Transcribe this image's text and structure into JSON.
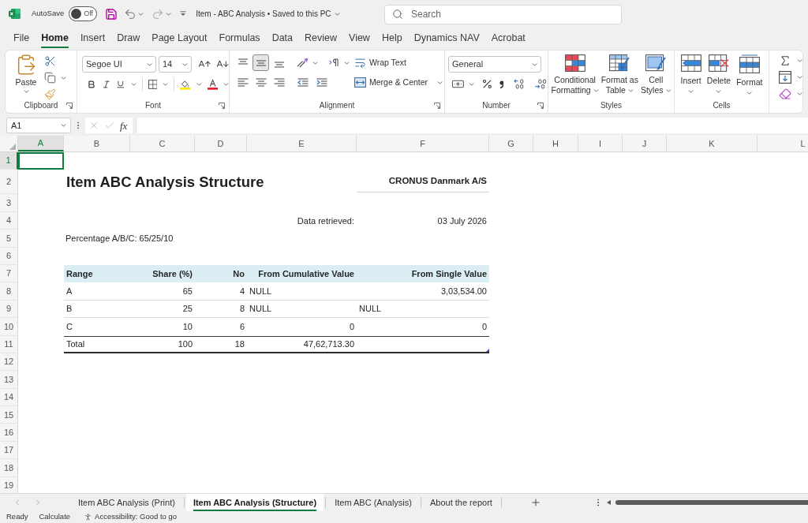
{
  "title_bar": {
    "autosave": {
      "label": "AutoSave",
      "state_label": "Off",
      "on": false
    },
    "document_title": "Item - ABC Analysis • Saved to this PC",
    "search": {
      "placeholder": "Search"
    }
  },
  "ribbon_tabs": [
    {
      "label": "File",
      "selected": false
    },
    {
      "label": "Home",
      "selected": true
    },
    {
      "label": "Insert",
      "selected": false
    },
    {
      "label": "Draw",
      "selected": false
    },
    {
      "label": "Page Layout",
      "selected": false
    },
    {
      "label": "Formulas",
      "selected": false
    },
    {
      "label": "Data",
      "selected": false
    },
    {
      "label": "Review",
      "selected": false
    },
    {
      "label": "View",
      "selected": false
    },
    {
      "label": "Help",
      "selected": false
    },
    {
      "label": "Dynamics NAV",
      "selected": false
    },
    {
      "label": "Acrobat",
      "selected": false
    }
  ],
  "ribbon": {
    "clipboard": {
      "label": "Clipboard",
      "paste": "Paste"
    },
    "font": {
      "label": "Font",
      "font_name": "Segoe UI",
      "font_size": "14"
    },
    "alignment": {
      "label": "Alignment",
      "vertical_align": [
        {
          "selected": false
        },
        {
          "selected": true
        },
        {
          "selected": false
        }
      ],
      "wrap_text": "Wrap Text",
      "merge": "Merge & Center"
    },
    "number": {
      "label": "Number",
      "format": "General"
    },
    "styles": {
      "label": "Styles",
      "buttons": [
        {
          "lines": [
            "Conditional",
            "Formatting"
          ]
        },
        {
          "lines": [
            "Format as",
            "Table"
          ]
        },
        {
          "lines": [
            "Cell",
            "Styles"
          ]
        }
      ]
    },
    "cells": {
      "label": "Cells",
      "buttons": [
        "Insert",
        "Delete",
        "Format"
      ]
    }
  },
  "formula_bar": {
    "name_box": "A1",
    "function_label": "fx"
  },
  "sheet": {
    "columns": [
      {
        "label": "A",
        "selected": true
      },
      {
        "label": "B",
        "selected": false
      },
      {
        "label": "C",
        "selected": false
      },
      {
        "label": "D",
        "selected": false
      },
      {
        "label": "E",
        "selected": false
      },
      {
        "label": "F",
        "selected": false
      },
      {
        "label": "G",
        "selected": false
      },
      {
        "label": "H",
        "selected": false
      },
      {
        "label": "I",
        "selected": false
      },
      {
        "label": "J",
        "selected": false
      },
      {
        "label": "K",
        "selected": false
      },
      {
        "label": "L",
        "selected": false
      }
    ],
    "rows": [
      {
        "label": "1",
        "selected": true
      },
      {
        "label": "2",
        "selected": false
      },
      {
        "label": "3",
        "selected": false
      },
      {
        "label": "4",
        "selected": false
      },
      {
        "label": "5",
        "selected": false
      },
      {
        "label": "6",
        "selected": false
      },
      {
        "label": "7",
        "selected": false
      },
      {
        "label": "8",
        "selected": false
      },
      {
        "label": "9",
        "selected": false
      },
      {
        "label": "10",
        "selected": false
      },
      {
        "label": "11",
        "selected": false
      },
      {
        "label": "12",
        "selected": false
      },
      {
        "label": "13",
        "selected": false
      },
      {
        "label": "14",
        "selected": false
      },
      {
        "label": "15",
        "selected": false
      },
      {
        "label": "16",
        "selected": false
      },
      {
        "label": "17",
        "selected": false
      },
      {
        "label": "18",
        "selected": false
      },
      {
        "label": "19",
        "selected": false
      }
    ],
    "report": {
      "title": "Item ABC Analysis Structure",
      "company": "CRONUS Danmark A/S",
      "retrieved_label": "Data retrieved:",
      "retrieved_date": "03 July 2026",
      "percentages": "Percentage A/B/C: 65/25/10",
      "table": {
        "columns": [
          {
            "label": "Range",
            "kind": "text"
          },
          {
            "label": "Share (%)",
            "kind": "number"
          },
          {
            "label": "No",
            "kind": "number"
          },
          {
            "label": "From Cumulative Value",
            "kind": "number"
          },
          {
            "label": "From Single Value",
            "kind": "number"
          }
        ],
        "rows": [
          {
            "kind": "data",
            "cells": [
              {
                "value": "A",
                "kind": "text"
              },
              {
                "value": "65",
                "kind": "number"
              },
              {
                "value": "4",
                "kind": "number"
              },
              {
                "value": "NULL",
                "kind": "text"
              },
              {
                "value": "3,03,534.00",
                "kind": "number"
              }
            ]
          },
          {
            "kind": "data",
            "cells": [
              {
                "value": "B",
                "kind": "text"
              },
              {
                "value": "25",
                "kind": "number"
              },
              {
                "value": "8",
                "kind": "number"
              },
              {
                "value": "NULL",
                "kind": "text"
              },
              {
                "value": "NULL",
                "kind": "text"
              }
            ]
          },
          {
            "kind": "data",
            "cells": [
              {
                "value": "C",
                "kind": "text"
              },
              {
                "value": "10",
                "kind": "number"
              },
              {
                "value": "6",
                "kind": "number"
              },
              {
                "value": "0",
                "kind": "number"
              },
              {
                "value": "0",
                "kind": "number"
              }
            ]
          },
          {
            "kind": "total",
            "cells": [
              {
                "value": "Total",
                "kind": "text"
              },
              {
                "value": "100",
                "kind": "number"
              },
              {
                "value": "18",
                "kind": "number"
              },
              {
                "value": "47,62,713.30",
                "kind": "number"
              }
            ]
          }
        ]
      }
    }
  },
  "sheet_tabs": [
    {
      "label": "Item ABC Analysis (Print)",
      "selected": false
    },
    {
      "label": "Item ABC Analysis (Structure)",
      "selected": true
    },
    {
      "label": "Item ABC (Analysis)",
      "selected": false
    },
    {
      "label": "About the report",
      "selected": false
    }
  ],
  "status_bar": {
    "mode": "Ready",
    "calculation": "Calculate",
    "accessibility": "Accessibility: Good to go"
  }
}
